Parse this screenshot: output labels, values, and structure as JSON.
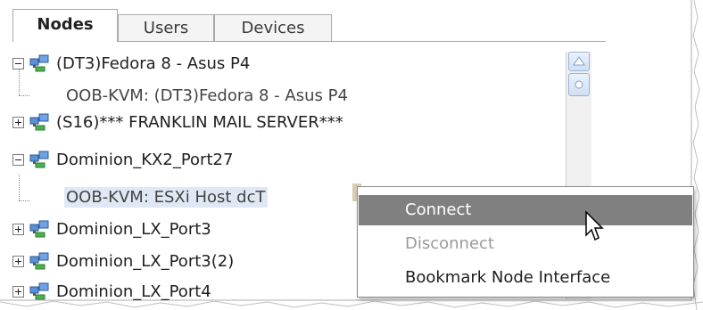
{
  "tabs": [
    {
      "label": "Nodes",
      "active": true
    },
    {
      "label": "Users",
      "active": false
    },
    {
      "label": "Devices",
      "active": false
    }
  ],
  "tree": {
    "nodes": [
      {
        "label": "(DT3)Fedora 8 - Asus P4",
        "expanded": true,
        "icon": "node-computer-icon"
      },
      {
        "label": "OOB-KVM: (DT3)Fedora 8 - Asus P4",
        "child": true
      },
      {
        "label": "(S16)*** FRANKLIN MAIL SERVER***",
        "expanded": false,
        "icon": "node-computer-icon"
      },
      {
        "label": "Dominion_KX2_Port27",
        "expanded": true,
        "icon": "node-computer-icon"
      },
      {
        "label": "OOB-KVM: ESXi Host dcT",
        "child": true,
        "selected": true
      },
      {
        "label": "Dominion_LX_Port3",
        "expanded": false,
        "icon": "node-computer-icon"
      },
      {
        "label": "Dominion_LX_Port3(2)",
        "expanded": false,
        "icon": "node-computer-icon"
      },
      {
        "label": "Dominion_LX_Port4",
        "expanded": false,
        "icon": "node-computer-icon"
      }
    ]
  },
  "context_menu": {
    "items": [
      {
        "label": "Connect",
        "highlighted": true,
        "enabled": true
      },
      {
        "label": "Disconnect",
        "highlighted": false,
        "enabled": false
      },
      {
        "label": "Bookmark Node Interface",
        "highlighted": false,
        "enabled": true
      }
    ]
  },
  "colors": {
    "menu_highlight": "#808080",
    "selection": "#dfe8f4",
    "disabled_text": "#9a9a9a"
  }
}
